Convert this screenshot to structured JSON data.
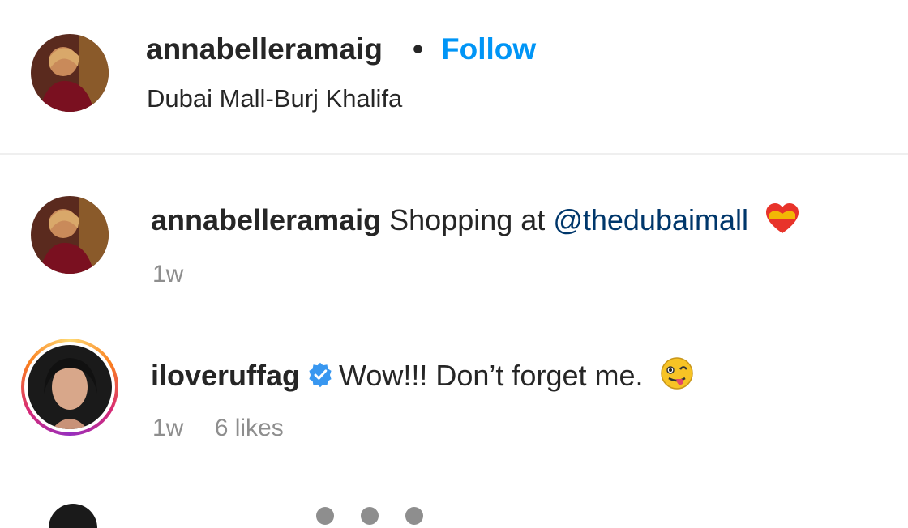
{
  "post_header": {
    "username": "annabelleramaig",
    "separator": "•",
    "follow_label": "Follow",
    "location": "Dubai Mall-Burj Khalifa"
  },
  "comments": [
    {
      "username": "annabelleramaig",
      "text_before": "Shopping at ",
      "mention": "@thedubaimall",
      "emoji": "heart-emoji",
      "time": "1w"
    },
    {
      "username": "iloveruffag",
      "verified": true,
      "text": "Wow!!! Don’t forget me.",
      "emoji": "winking-tongue-emoji",
      "time": "1w",
      "likes": "6 likes"
    }
  ],
  "colors": {
    "follow": "#0095f6",
    "mention": "#00376b",
    "meta": "#8e8e8e",
    "verified": "#3897f0",
    "divider": "#efefef"
  }
}
